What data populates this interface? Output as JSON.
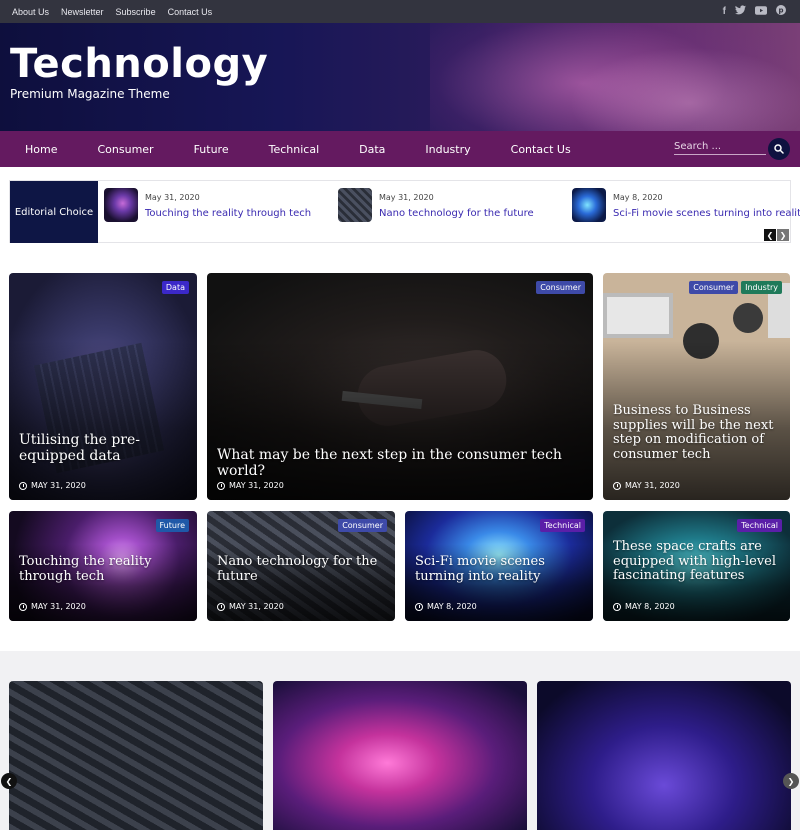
{
  "topbar": {
    "links": [
      "About Us",
      "Newsletter",
      "Subscribe",
      "Contact Us"
    ],
    "social_icons": [
      "facebook-icon",
      "twitter-icon",
      "youtube-icon",
      "pinterest-icon"
    ]
  },
  "header": {
    "title": "Technology",
    "tagline": "Premium Magazine Theme"
  },
  "nav": {
    "items": [
      "Home",
      "Consumer",
      "Future",
      "Technical",
      "Data",
      "Industry",
      "Contact Us"
    ],
    "search_placeholder": "Search ..."
  },
  "ticker": {
    "label": "Editorial Choice",
    "items": [
      {
        "date": "May 31, 2020",
        "title": "Touching the reality through tech"
      },
      {
        "date": "May 31, 2020",
        "title": "Nano technology for the future"
      },
      {
        "date": "May 8, 2020",
        "title": "Sci-Fi movie scenes turning into reality"
      }
    ]
  },
  "featured": [
    {
      "tags": [
        "Data"
      ],
      "title": "Utilising the pre-equipped data",
      "date": "MAY 31, 2020"
    },
    {
      "tags": [
        "Consumer"
      ],
      "title": "What may be the next step in the consumer tech world?",
      "date": "MAY 31, 2020"
    },
    {
      "tags": [
        "Consumer",
        "Industry"
      ],
      "title": "Business to Business supplies will be the next step on modification of consumer tech",
      "date": "MAY 31, 2020"
    }
  ],
  "small_cards": [
    {
      "tags": [
        "Future"
      ],
      "title": "Touching the reality through tech",
      "date": "MAY 31, 2020"
    },
    {
      "tags": [
        "Consumer"
      ],
      "title": "Nano technology for the future",
      "date": "MAY 31, 2020"
    },
    {
      "tags": [
        "Technical"
      ],
      "title": "Sci-Fi movie scenes turning into reality",
      "date": "MAY 8, 2020"
    },
    {
      "tags": [
        "Technical"
      ],
      "title": "These space crafts are equipped with high-level fascinating features",
      "date": "MAY 8, 2020"
    }
  ],
  "colors": {
    "topbar": "#33343f",
    "nav": "#641a60",
    "editorial_label": "#0e1645",
    "tag_data": "#3b28c8",
    "tag_consumer": "#3e4aa8",
    "tag_industry": "#1f7a5a",
    "tag_future": "#1f58a8",
    "tag_technical": "#5a1fa8",
    "link": "#3a2ab0"
  }
}
